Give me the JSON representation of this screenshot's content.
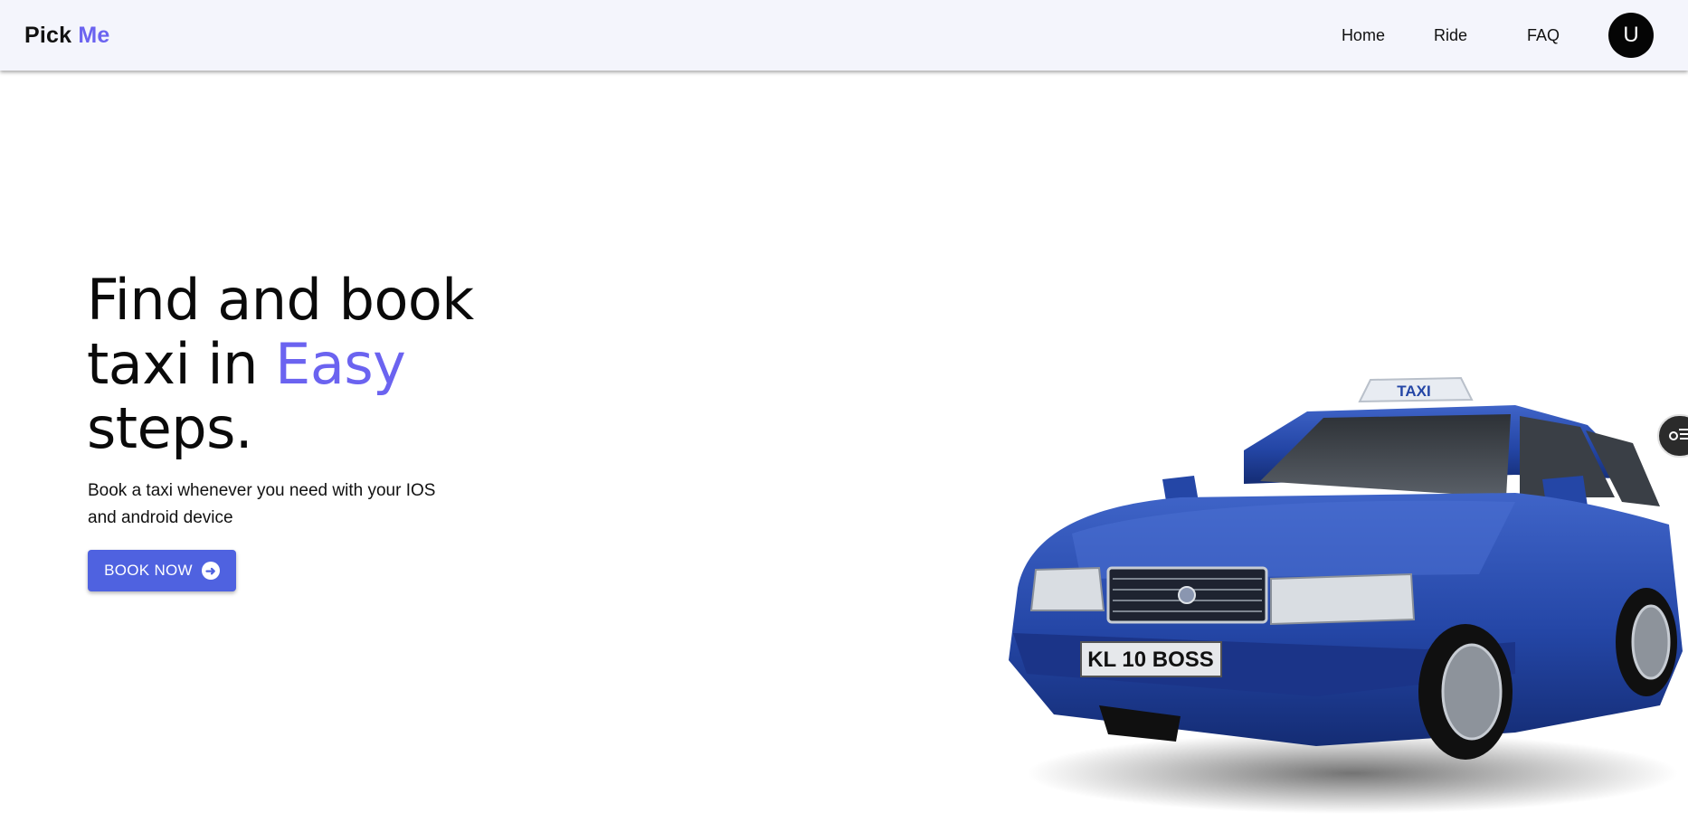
{
  "brand": {
    "name_part1": "Pick",
    "name_part2": "Me"
  },
  "nav": {
    "items": [
      {
        "label": "Home"
      },
      {
        "label": "Ride"
      },
      {
        "label": "FAQ"
      }
    ],
    "avatar_initial": "U"
  },
  "hero": {
    "title_line1": "Find and book",
    "title_line2_prefix": "taxi in ",
    "title_line2_accent": "Easy",
    "title_line3": "steps.",
    "subtitle": "Book a taxi whenever you need with your IOS and android device",
    "cta_label": "BOOK NOW"
  },
  "car": {
    "roof_sign": "TAXI",
    "plate": "KL 10 BOSS"
  },
  "colors": {
    "accent": "#6b63f0",
    "button": "#4f62e0",
    "navbar_bg": "#f4f5fc",
    "car_body": "#2a4aa8"
  },
  "icons": {
    "cta_icon": "arrow-right-circle-icon",
    "side_widget_icon": "settings-list-icon"
  }
}
